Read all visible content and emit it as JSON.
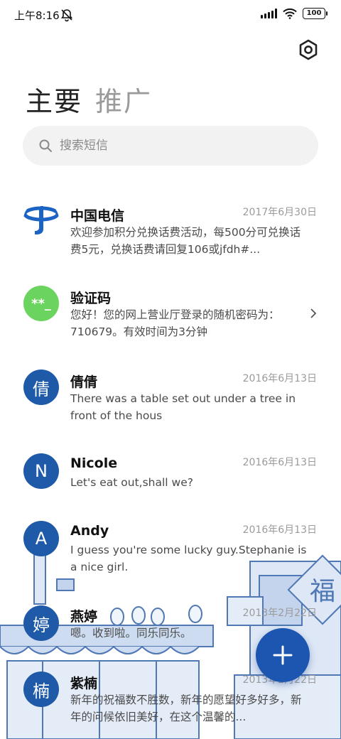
{
  "status_bar": {
    "time": "上午8:16",
    "battery": "100",
    "icons": [
      "bell-off-icon",
      "signal-icon",
      "wifi-icon",
      "battery-icon"
    ]
  },
  "header": {
    "settings_icon": "settings-hexagon-icon",
    "tabs": [
      {
        "label": "主要",
        "active": true
      },
      {
        "label": "推广",
        "active": false
      }
    ]
  },
  "search": {
    "placeholder": "搜索短信",
    "icon": "search-icon"
  },
  "conversations": [
    {
      "name": "中国电信",
      "date": "2017年6月30日",
      "snippet": "欢迎参加积分兑换话费活动，每500分可兑换话费5元，兑换话费请回复106或jfdh#...",
      "avatar": "china-telecom-logo"
    },
    {
      "name": "验证码",
      "date": "",
      "snippet": "您好！您的网上营业厅登录的随机密码为：710679。有效时间为3分钟",
      "avatar_text": "**_"
    },
    {
      "name": "倩倩",
      "date": "2016年6月13日",
      "snippet": "There was a table set out under a tree in front of the hous",
      "avatar_text": "倩"
    },
    {
      "name": "Nicole",
      "date": "2016年6月13日",
      "snippet": "Let's eat out,shall we?",
      "avatar_text": "N"
    },
    {
      "name": "Andy",
      "date": "2016年6月13日",
      "snippet": "I guess you're some lucky guy.Stephanie is a nice girl.",
      "avatar_text": "A"
    },
    {
      "name": "燕婷",
      "date": "2013年2月22日",
      "snippet": "嗯。收到啦。同乐同乐。",
      "avatar_text": "婷"
    },
    {
      "name": "紫楠",
      "date": "2013年2月22日",
      "snippet": "新年的祝福数不胜数，新年的愿望好多好多，新年的问候依旧美好，在这个温馨的...",
      "avatar_text": "楠"
    }
  ],
  "scenery": {
    "sign_text": "福"
  },
  "fab": {
    "icon": "plus-icon"
  },
  "colors": {
    "accent": "#1e5aa8",
    "green": "#6ad45e",
    "search_bg": "#f2f2f2"
  }
}
